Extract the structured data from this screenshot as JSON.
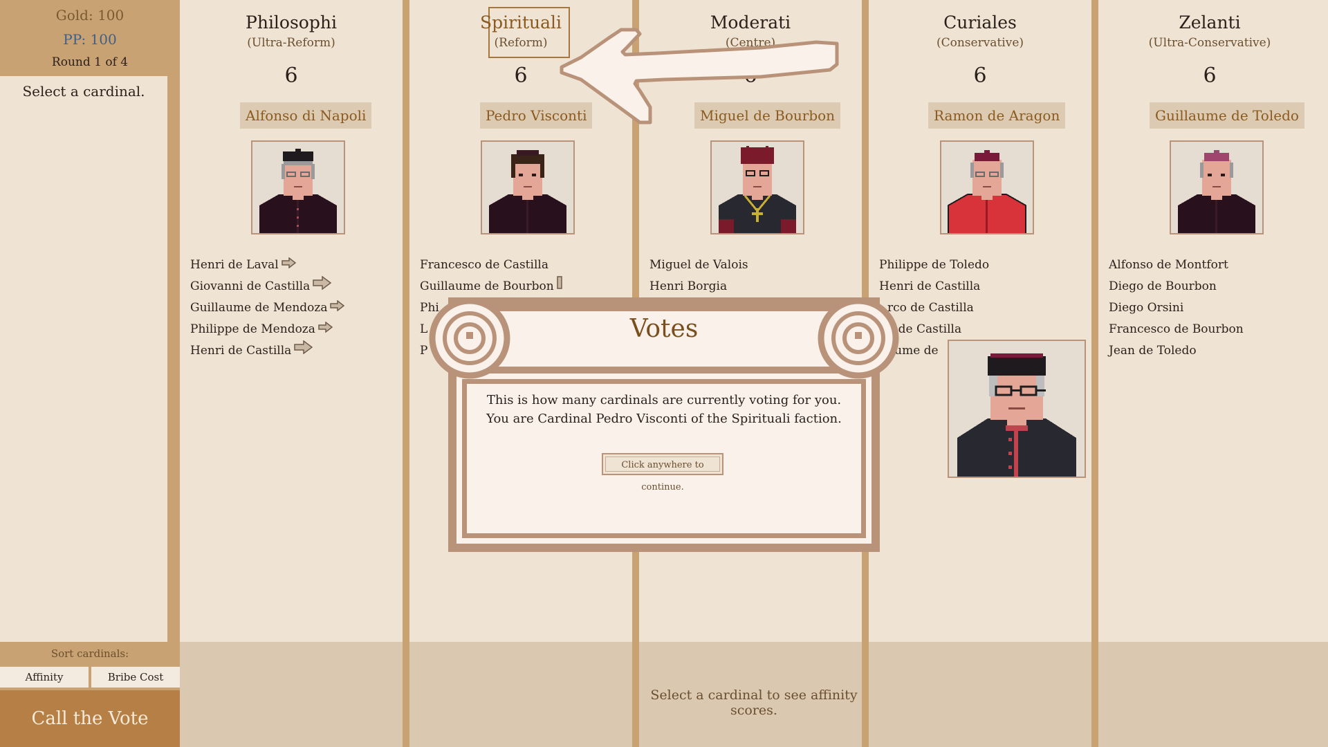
{
  "sidebar": {
    "gold": "Gold: 100",
    "pp": "PP: 100",
    "round": "Round 1 of 4",
    "select_message": "Select a cardinal.",
    "sort_label": "Sort cardinals:",
    "sort_affinity": "Affinity",
    "sort_bribe": "Bribe Cost",
    "call_vote": "Call the Vote"
  },
  "factions": [
    {
      "name": "Philosophi",
      "subtitle": "(Ultra-Reform)",
      "votes": "6",
      "leader": "Alfonso di Napoli",
      "members": [
        "Henri de Laval",
        "Giovanni de Castilla",
        "Guillaume de Mendoza",
        "Philippe de Mendoza",
        "Henri de Castilla"
      ]
    },
    {
      "name": "Spirituali",
      "subtitle": "(Reform)",
      "votes": "6",
      "leader": "Pedro Visconti",
      "members": [
        "Francesco de Castilla",
        "Guillaume de Bourbon",
        "Phi",
        "L",
        "P"
      ]
    },
    {
      "name": "Moderati",
      "subtitle": "(Centre)",
      "votes": "6",
      "leader": "Miguel de Bourbon",
      "members": [
        "Miguel de Valois",
        "Henri Borgia"
      ]
    },
    {
      "name": "Curiales",
      "subtitle": "(Conservative)",
      "votes": "6",
      "leader": "Ramon de Aragon",
      "members": [
        "Philippe de Toledo",
        "Henri de Castilla",
        "rco de Castilla",
        "o de Castilla",
        "aume de"
      ]
    },
    {
      "name": "Zelanti",
      "subtitle": "(Ultra-Conservative)",
      "votes": "6",
      "leader": "Guillaume de Toledo",
      "members": [
        "Alfonso de Montfort",
        "Diego de Bourbon",
        "Diego Orsini",
        "Francesco de Bourbon",
        "Jean de Toledo"
      ]
    }
  ],
  "affinity_hint": "Select a cardinal to see affinity scores.",
  "modal": {
    "title": "Votes",
    "body": "This is how many cardinals are currently voting for you. You are Cardinal Pedro Visconti of the Spirituali faction.",
    "continue": "Click anywhere to continue."
  },
  "colors": {
    "gold": "#7a5a30",
    "pp": "#3f5f88",
    "call_vote_bg": "#b57f45",
    "leader_text": "#8a5a20",
    "panel_bg": "#efe3d3",
    "frame": "#b8937a"
  }
}
